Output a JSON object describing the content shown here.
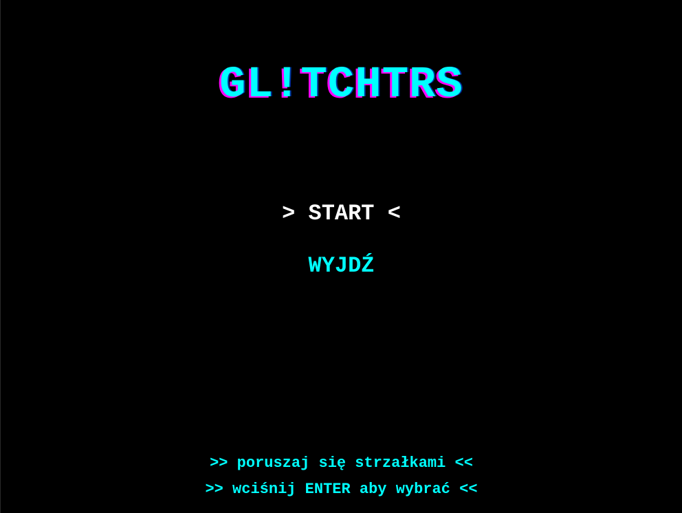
{
  "game": {
    "title": "GL!TCHTRS",
    "menu": [
      {
        "label": "> START <",
        "selected": true
      },
      {
        "label": "WYJDŹ",
        "selected": false
      }
    ],
    "hints": [
      ">> poruszaj się strzałkami <<",
      ">> wciśnij ENTER aby wybrać <<"
    ]
  },
  "colors": {
    "background": "#000000",
    "primary": "#00ffff",
    "title_glitch_shadow": "#ff00ff",
    "selected": "#ffffff"
  }
}
